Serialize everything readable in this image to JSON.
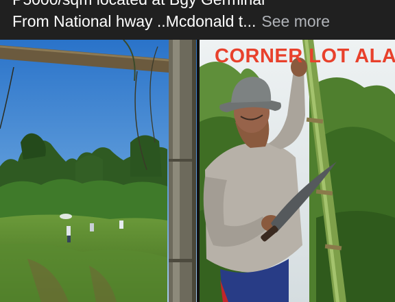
{
  "post": {
    "caption_line1": "P5000/sqm located at Bgy Germinal",
    "caption_line2": "From National hway ..Mcdonald t...",
    "see_more_label": "See more"
  },
  "photos": [
    {
      "description_icon": "field-photo-icon"
    },
    {
      "overlay_text": "CORNER LOT ALA",
      "description_icon": "man-with-bamboo-photo-icon"
    }
  ],
  "colors": {
    "caption_bg": "#202020",
    "overlay_red": "#e8412c",
    "see_more": "#b0b3b8"
  }
}
